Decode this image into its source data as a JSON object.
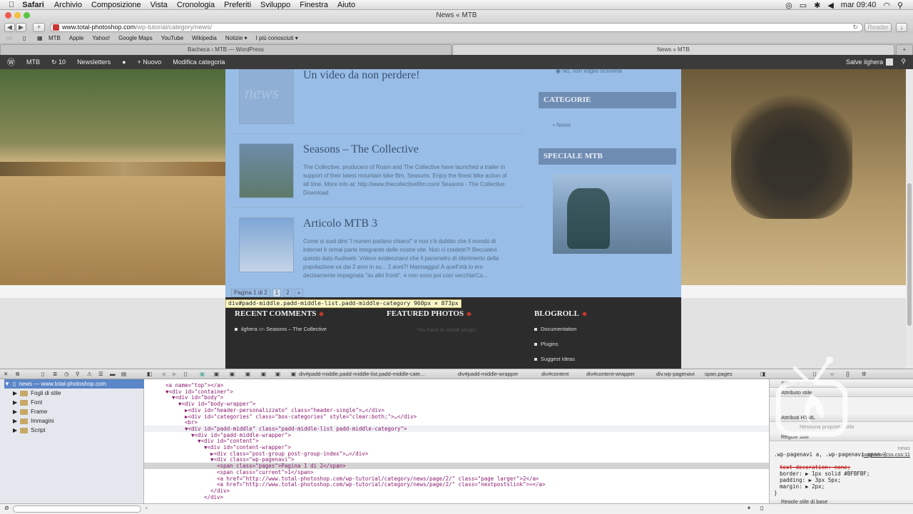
{
  "menubar": {
    "app": "Safari",
    "items": [
      "Archivio",
      "Composizione",
      "Vista",
      "Cronologia",
      "Preferiti",
      "Sviluppo",
      "Finestra",
      "Aiuto"
    ],
    "clock": "mar 09:40"
  },
  "window": {
    "title": "News « MTB"
  },
  "toolbar": {
    "url_host": "www.total-photoshop.com",
    "url_path": "/wp-tutorial/category/news/",
    "reader": "Reader"
  },
  "bookmarks": [
    "MTB",
    "Apple",
    "Yahoo!",
    "Google Maps",
    "YouTube",
    "Wikipedia",
    "Notizie ▾",
    "I più conosciuti ▾"
  ],
  "tabs": [
    {
      "label": "Bacheca ‹ MTB — WordPress"
    },
    {
      "label": "News « MTB"
    }
  ],
  "adminbar": {
    "site": "MTB",
    "updates": "10",
    "newsletters": "Newsletters",
    "new": "Nuovo",
    "edit": "Modifica categoria",
    "user": "Salve ilghera"
  },
  "posts": [
    {
      "title": "Un video da non perdere!",
      "thumb_text": "news",
      "excerpt": ""
    },
    {
      "title": "Seasons – The Collective",
      "excerpt": "The Collective, producers of Roam and The Collective have launched a trailer in support of their latest mountain bike film, Seasons. Enjoy the finest bike action of all time. More info at: http://www.thecollectivefilm.com/      Seasons - The Collective Download"
    },
    {
      "title": "Articolo MTB 3",
      "excerpt": "Come si suol dire \"i numeri parlano chiaro!\" e non c'è dubbio che il mondo di internet è ormai parte integrante delle nostre vite. Non ci credete?! Beccatevi questo dato Audiweb: Volevo evidenziarvi che il parametro di riferimento della popolazione va dai 2 anni in su... 2 anni?! Mannaggia! A quell'età io ero decisamente impegnata \"su altri fronti\", e non sono poi così vecchia!Co..."
    }
  ],
  "sidebar": {
    "radio": "No, non voglio riceverla",
    "categorie_title": "CATEGORIE",
    "categorie_item": "News",
    "speciale_title": "SPECIALE MTB"
  },
  "pager": {
    "info": "Pagina 1 di 2",
    "current": "1",
    "next_page": "2",
    "next": "»"
  },
  "tooltip": {
    "text": "div#padd-middle.padd-middle-list.padd-middle-category 960px × 873px"
  },
  "footer": {
    "recent_title": "RECENT COMMENTS",
    "recent_author": "ilghera",
    "recent_on": "on",
    "recent_link": "Seasons – The Collective",
    "photos_title": "FEATURED PHOTOS",
    "photos_msg": "You have to install plugin.",
    "blogroll_title": "BLOGROLL",
    "blogroll_items": [
      "Documentation",
      "Plugins",
      "Suggest Ideas"
    ]
  },
  "devtools": {
    "crumbs": [
      "div#padd-middle.padd-middle-list.padd-middle-cate...",
      "div#padd-middle-wrapper",
      "div#content",
      "div#content-wrapper",
      "div.wp-pagenavi",
      "span.pages"
    ],
    "tree": {
      "root": "news — www.total-photoshop.com",
      "folders": [
        "Fogli di stile",
        "Font",
        "Frame",
        "Immagini",
        "Script"
      ]
    },
    "dom": [
      {
        "i": 0,
        "t": "<a name=\"top\"></a>"
      },
      {
        "i": 0,
        "t": "▼<div id=\"container\">"
      },
      {
        "i": 1,
        "t": "▼<div id=\"body\">"
      },
      {
        "i": 2,
        "t": "▼<div id=\"body-wrapper\">"
      },
      {
        "i": 3,
        "t": "▶<div id=\"header-personalizzato\" class=\"header-single\">…</div>"
      },
      {
        "i": 3,
        "t": "▶<div id=\"categories\" class=\"box-categories\" style=\"clear:both;\">…</div>"
      },
      {
        "i": 3,
        "t": "<br>"
      },
      {
        "i": 3,
        "t": "▼<div id=\"padd-middle\" class=\"padd-middle-list padd-middle-category\">"
      },
      {
        "i": 4,
        "t": "▼<div id=\"padd-middle-wrapper\">"
      },
      {
        "i": 5,
        "t": "▼<div id=\"content\">"
      },
      {
        "i": 6,
        "t": "▼<div id=\"content-wrapper\">"
      },
      {
        "i": 7,
        "t": "▶<div class=\"post-group post-group-index\">…</div>"
      },
      {
        "i": 7,
        "t": "▼<div class=\"wp-pagenavi\">"
      },
      {
        "i": 8,
        "t": "<span class=\"pages\">Pagina 1 di 2</span>"
      },
      {
        "i": 8,
        "t": "<span class=\"current\">1</span>"
      },
      {
        "i": 8,
        "t": "<a href=\"http://www.total-photoshop.com/wp-tutorial/category/news/page/2/\" class=\"page larger\">2</a>"
      },
      {
        "i": 8,
        "t": "<a href=\"http://www.total-photoshop.com/wp-tutorial/category/news/page/2/\" class=\"nextpostslink\">»</a>"
      },
      {
        "i": 7,
        "t": "</div>"
      },
      {
        "i": 6,
        "t": "</div>"
      }
    ],
    "styles": {
      "computed": "Stile calcolato",
      "style_attr": "Attributo stile",
      "html_attr": "Attributi HTML",
      "no_prop": "Nessuna proprietà stile",
      "rules": "Regole stile",
      "rules_src": "news",
      "selector": ".wp-pagenavi a, .wp-pagenavi span {",
      "file": "pagenavi-css.css:11",
      "decl": [
        "text-decoration: none;",
        "border: ▶ 1px solid #BFBFBF;",
        "padding: ▶ 3px 5px;",
        "margin: ▶ 2px;"
      ],
      "close": "}",
      "base": "Regole stile di base"
    }
  },
  "colors": {
    "accent": "#c0392b",
    "highlight": "#a9c8e8",
    "admin": "#3b3b3b"
  }
}
